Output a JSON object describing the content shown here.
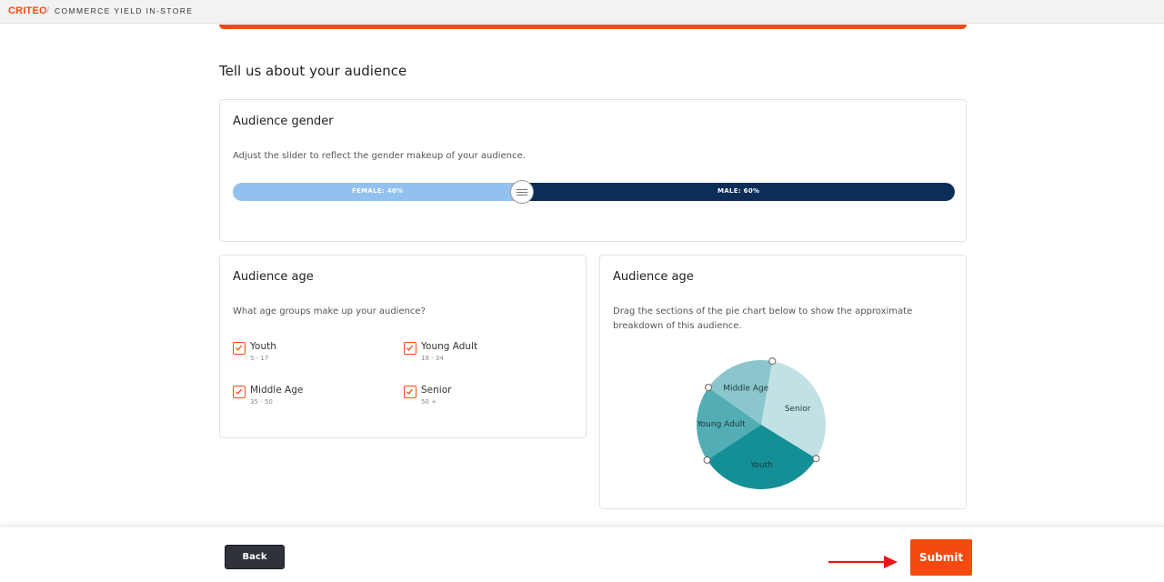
{
  "header": {
    "logo": "CRITEO",
    "separator": "//",
    "product": "COMMERCE YIELD IN-STORE"
  },
  "page": {
    "heading": "Tell us about your audience"
  },
  "gender": {
    "title": "Audience gender",
    "description": "Adjust the slider to reflect the gender makeup of your audience.",
    "female_label": "FEMALE: 40%",
    "male_label": "MALE: 60%",
    "female_percent": 40,
    "male_percent": 60,
    "colors": {
      "female": "#93c1ef",
      "male": "#0b2d57"
    }
  },
  "age": {
    "title": "Audience age",
    "question": "What age groups make up your audience?",
    "groups": [
      {
        "name": "Youth",
        "range": "5 - 17",
        "checked": true
      },
      {
        "name": "Young Adult",
        "range": "18 - 34",
        "checked": true
      },
      {
        "name": "Middle Age",
        "range": "35 - 50",
        "checked": true
      },
      {
        "name": "Senior",
        "range": "50 +",
        "checked": true
      }
    ]
  },
  "age_breakdown": {
    "title": "Audience age",
    "description": "Drag the sections of the pie chart below to show the approximate breakdown of this audience.",
    "chart_data": {
      "type": "pie",
      "slices": [
        {
          "label": "Senior",
          "value": 31,
          "color": "#c2e1e5"
        },
        {
          "label": "Youth",
          "value": 32,
          "color": "#148f96"
        },
        {
          "label": "Young Adult",
          "value": 19,
          "color": "#53adb5"
        },
        {
          "label": "Middle Age",
          "value": 18,
          "color": "#8bc6cd"
        }
      ],
      "start_angle_deg": -80,
      "direction": "clockwise"
    }
  },
  "footer": {
    "back_label": "Back",
    "submit_label": "Submit",
    "accent": "#f54a0f",
    "arrow_color": "#e8161b"
  }
}
